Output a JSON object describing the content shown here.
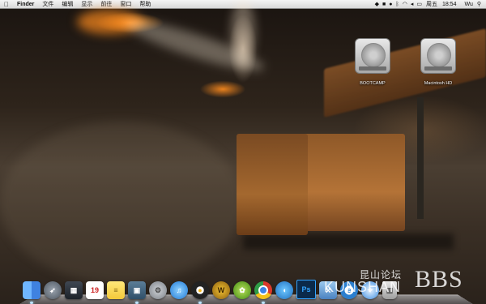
{
  "menubar": {
    "app_name": "Finder",
    "menus": [
      "文件",
      "编辑",
      "显示",
      "前往",
      "窗口",
      "帮助"
    ],
    "status_icons": [
      "dropbox-icon",
      "camera-icon",
      "qq-icon",
      "bluetooth-icon",
      "wifi-icon",
      "volume-icon",
      "battery-icon"
    ],
    "day": "周五",
    "time": "18:54",
    "user": "Wu"
  },
  "desktop": {
    "icons": [
      {
        "label": "BOOTCAMP",
        "icon": "hard-drive-icon"
      },
      {
        "label": "Macintosh HD",
        "icon": "hard-drive-icon"
      }
    ]
  },
  "dock": {
    "items": [
      {
        "name": "Finder",
        "icon": "finder-icon"
      },
      {
        "name": "Launchpad",
        "icon": "launchpad-icon"
      },
      {
        "name": "Mission Control",
        "icon": "mission-control-icon"
      },
      {
        "name": "iCal",
        "icon": "calendar-icon",
        "text": "19"
      },
      {
        "name": "Stickies",
        "icon": "stickies-icon"
      },
      {
        "name": "iPhoto",
        "icon": "iphoto-icon"
      },
      {
        "name": "System Preferences",
        "icon": "preferences-icon"
      },
      {
        "name": "iTunes",
        "icon": "itunes-icon"
      },
      {
        "name": "QQ",
        "icon": "qq-icon"
      },
      {
        "name": "World of Warcraft",
        "icon": "wow-icon",
        "text": "W"
      },
      {
        "name": "Aliwangwang",
        "icon": "wangwang-icon"
      },
      {
        "name": "Chrome",
        "icon": "chrome-icon"
      },
      {
        "name": "Twitter client",
        "icon": "bird-icon"
      },
      {
        "name": "Photoshop",
        "icon": "photoshop-icon",
        "text": "Ps"
      },
      {
        "name": "Xcode",
        "icon": "xcode-icon"
      },
      {
        "name": "Internet Explorer",
        "icon": "ie-icon",
        "text": "e"
      },
      {
        "name": "Safari",
        "icon": "safari-icon"
      },
      {
        "name": "Trash",
        "icon": "trash-icon"
      }
    ]
  },
  "watermark": {
    "chinese": "昆山论坛",
    "latin": "KUNSHAN",
    "bbs": "BBS"
  }
}
